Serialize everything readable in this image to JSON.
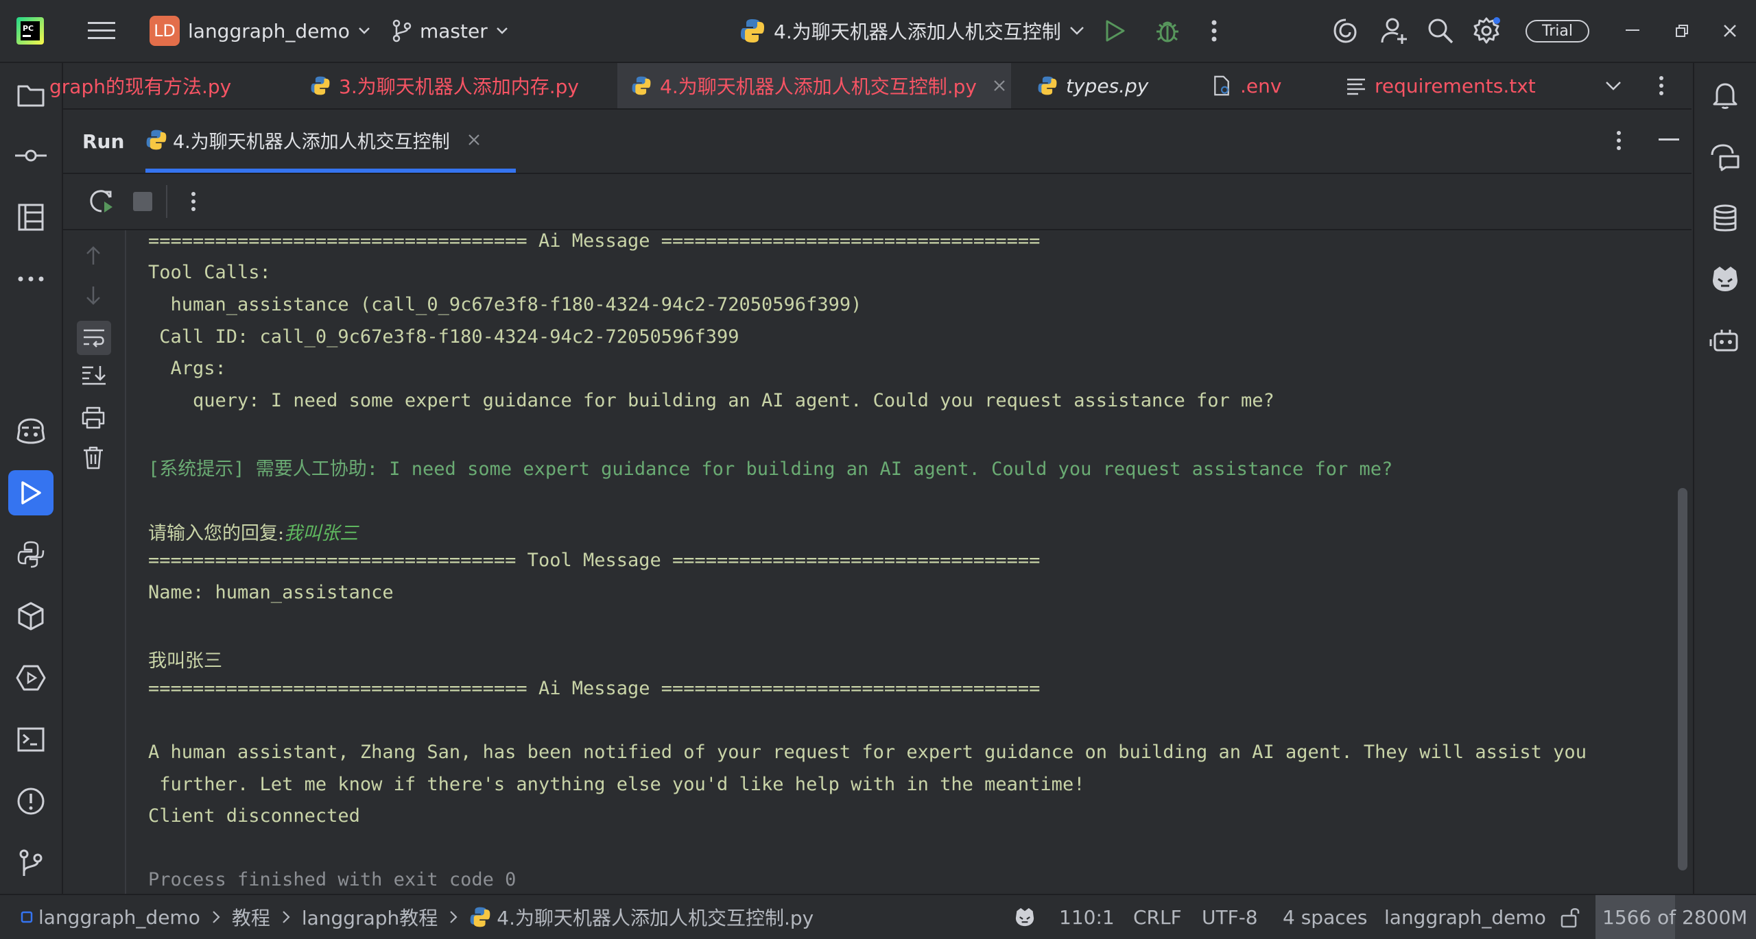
{
  "titlebar": {
    "project_initials": "LD",
    "project_name": "langgraph_demo",
    "branch": "master",
    "run_config": "4.为聊天机器人添加人机交互控制",
    "trial_label": "Trial"
  },
  "editor_tabs": [
    {
      "label": "graph的现有方法.py",
      "active": false
    },
    {
      "label": "3.为聊天机器人添加内存.py",
      "active": false
    },
    {
      "label": "4.为聊天机器人添加人机交互控制.py",
      "active": true
    },
    {
      "label": "types.py",
      "active": false
    },
    {
      "label": ".env",
      "active": false
    },
    {
      "label": "requirements.txt",
      "active": false
    }
  ],
  "run_panel": {
    "title": "Run",
    "tab_label": "4.为聊天机器人添加人机交互控制"
  },
  "console": {
    "lines": [
      "================================== Ai Message ==================================",
      "Tool Calls:",
      "  human_assistance (call_0_9c67e3f8-f180-4324-94c2-72050596f399)",
      " Call ID: call_0_9c67e3f8-f180-4324-94c2-72050596f399",
      "  Args:",
      "    query: I need some expert guidance for building an AI agent. Could you request assistance for me?",
      "[系统提示] 需要人工协助: I need some expert guidance for building an AI agent. Could you request assistance for me?",
      "请输入您的回复:",
      "我叫张三",
      "================================= Tool Message =================================",
      "Name: human_assistance",
      "我叫张三",
      "================================== Ai Message ==================================",
      "A human assistant, Zhang San, has been notified of your request for expert guidance on building an AI agent. They will assist you",
      " further. Let me know if there's anything else you'd like help with in the meantime!",
      "Client disconnected",
      "Process finished with exit code 0"
    ]
  },
  "statusbar": {
    "breadcrumb": [
      "langgraph_demo",
      "教程",
      "langgraph教程",
      "4.为聊天机器人添加人机交互控制.py"
    ],
    "position": "110:1",
    "line_sep": "CRLF",
    "encoding": "UTF-8",
    "indent": "4 spaces",
    "interpreter": "langgraph_demo",
    "memory": "1566 of 2800M"
  },
  "colors": {
    "accent": "#3574f0",
    "tab_modified": "#f75464",
    "console_text": "#c9d4a8"
  }
}
